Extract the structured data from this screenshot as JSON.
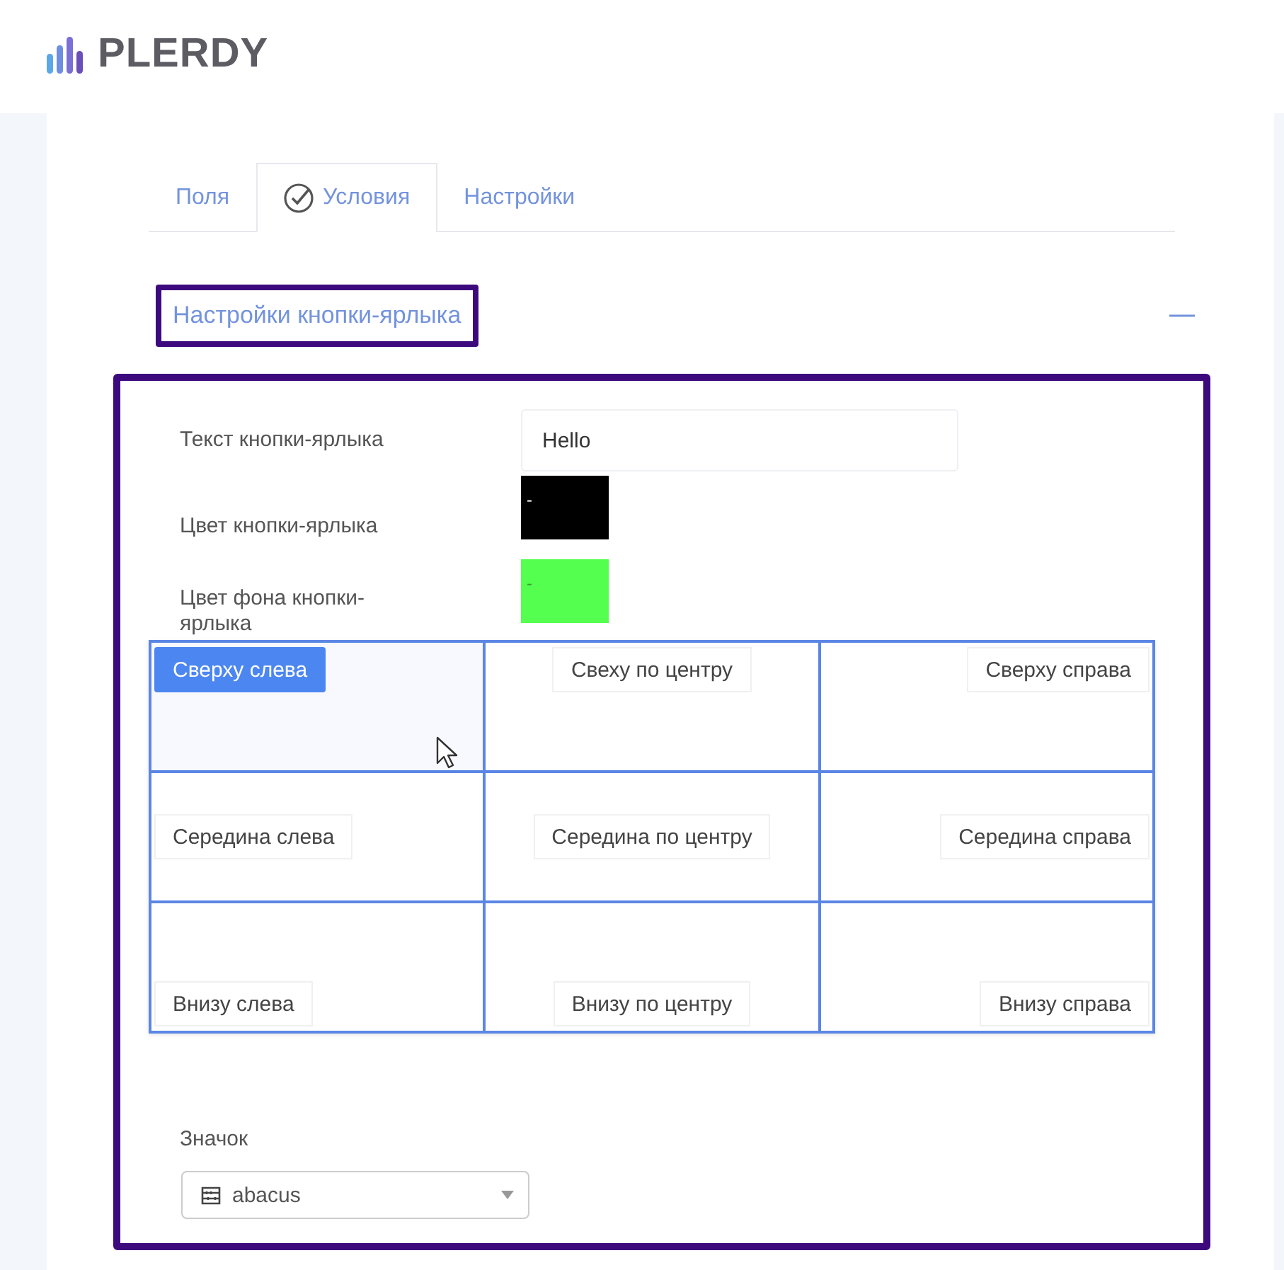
{
  "header": {
    "logo": "PLERDY"
  },
  "tabs": [
    {
      "label": "Поля",
      "selected": false,
      "done": false
    },
    {
      "label": "Условия",
      "selected": true,
      "done": true
    },
    {
      "label": "Настройки",
      "selected": false,
      "done": false
    }
  ],
  "section": {
    "title": "Настройки кнопки-ярлыка",
    "expanded": true,
    "highlighted": true
  },
  "settings": {
    "highlighted": true,
    "fields": [
      {
        "kind": "text",
        "label": "Текст кнопки-ярлыка",
        "value": "Hello"
      },
      {
        "kind": "color",
        "label": "Цвет кнопки-ярлыка",
        "value": "-",
        "color": "#000000"
      },
      {
        "kind": "color",
        "label": "Цвет фона кнопки-ярлыка",
        "value": "-",
        "color": "#55ff4f"
      }
    ],
    "positions": [
      {
        "label": "Сверху слева",
        "selected": true
      },
      {
        "label": "Свеху по центру",
        "selected": false
      },
      {
        "label": "Сверху справа",
        "selected": false
      },
      {
        "label": "Середина слева",
        "selected": false
      },
      {
        "label": "Середина по центру",
        "selected": false
      },
      {
        "label": "Середина справа",
        "selected": false
      },
      {
        "label": "Внизу слева",
        "selected": false
      },
      {
        "label": "Внизу по центру",
        "selected": false
      },
      {
        "label": "Внизу справа",
        "selected": false
      }
    ],
    "icon_select": {
      "label": "Значок",
      "value": "abacus"
    }
  }
}
